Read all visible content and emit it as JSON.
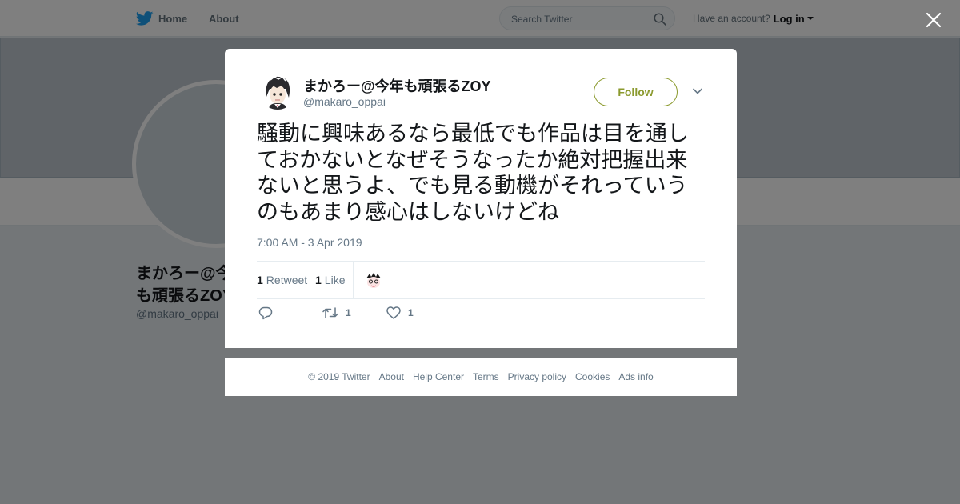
{
  "colors": {
    "accent": "#8b9a2e",
    "twitter_blue": "#1da1f2",
    "muted_text": "#657786",
    "overlay": "rgba(0,0,0,0.5)"
  },
  "topbar": {
    "home_label": "Home",
    "home_icon": "twitter-bird-icon",
    "about_label": "About",
    "search_placeholder": "Search Twitter",
    "search_icon": "search-icon",
    "account_prompt": "Have an account?",
    "login_label": "Log in"
  },
  "profile": {
    "name": "まかろー@今年も頑張るZOY",
    "handle": "@makaro_oppai"
  },
  "tweet": {
    "author_name": "まかろー@今年も頑張るZOY",
    "author_handle": "@makaro_oppai",
    "follow_label": "Follow",
    "text": "騒動に興味あるなら最低でも作品は目を通しておかないとなぜそうなったか絶対把握出来ないと思うよ、でも見る動機がそれっていうのもあまり感心はしないけどね",
    "timestamp": "7:00 AM - 3 Apr 2019",
    "retweet_count": "1",
    "retweet_label": "Retweet",
    "like_count": "1",
    "like_label": "Like",
    "action_retweet_count": "1",
    "action_like_count": "1"
  },
  "footer": {
    "links": [
      "© 2019 Twitter",
      "About",
      "Help Center",
      "Terms",
      "Privacy policy",
      "Cookies",
      "Ads info"
    ]
  }
}
